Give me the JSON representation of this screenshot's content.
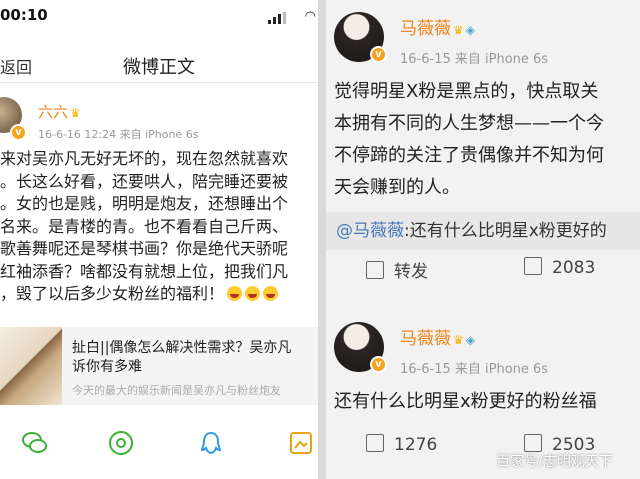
{
  "left": {
    "status_time": "00:10",
    "nav": {
      "back": "返回",
      "title": "微博正文"
    },
    "author": {
      "name": "六六",
      "meta": "16-6-16 12:24  来自 iPhone 6s"
    },
    "post_lines": [
      "来对吴亦凡无好无坏的，现在忽然就喜欢",
      "。长这么好看，还要哄人，陪完睡还要被",
      "。女的也是贱，明明是炮友，还想睡出个",
      "名来。是青楼的青。也不看看自己斤两、",
      "歌善舞呢还是琴棋书画？你是绝代天骄呢",
      "红袖添香？啥都没有就想上位，把我们凡",
      "，毁了以后多少女粉丝的福利！"
    ],
    "card": {
      "title_line1": "扯白||偶像怎么解决性需求？吴亦凡",
      "title_line2": "诉你有多难",
      "subtitle": "今天的最大的娱乐新闻是吴亦凡与粉丝炮友"
    }
  },
  "right": {
    "post1": {
      "name": "马薇薇",
      "meta": "16-6-15  来自 iPhone 6s",
      "lines": [
        "觉得明星X粉是黑点的，快点取关",
        "本拥有不同的人生梦想——一个今",
        "不停蹄的关注了贵偶像并不知为何",
        "天会赚到的人。"
      ],
      "quote_mention": "@马薇薇",
      "quote_text": ":还有什么比明星x粉更好的",
      "repost_label": "转发",
      "comment_count": "2083"
    },
    "post2": {
      "name": "马薇薇",
      "meta": "16-6-15  来自 iPhone 6s",
      "text": "还有什么比明星x粉更好的粉丝福",
      "repost_count": "1276",
      "comment_count": "2503"
    }
  },
  "watermark": "百家号/志明观天下",
  "colors": {
    "username": "#f08418",
    "mention": "#4a7ab8",
    "verified": "#f6a21d"
  }
}
